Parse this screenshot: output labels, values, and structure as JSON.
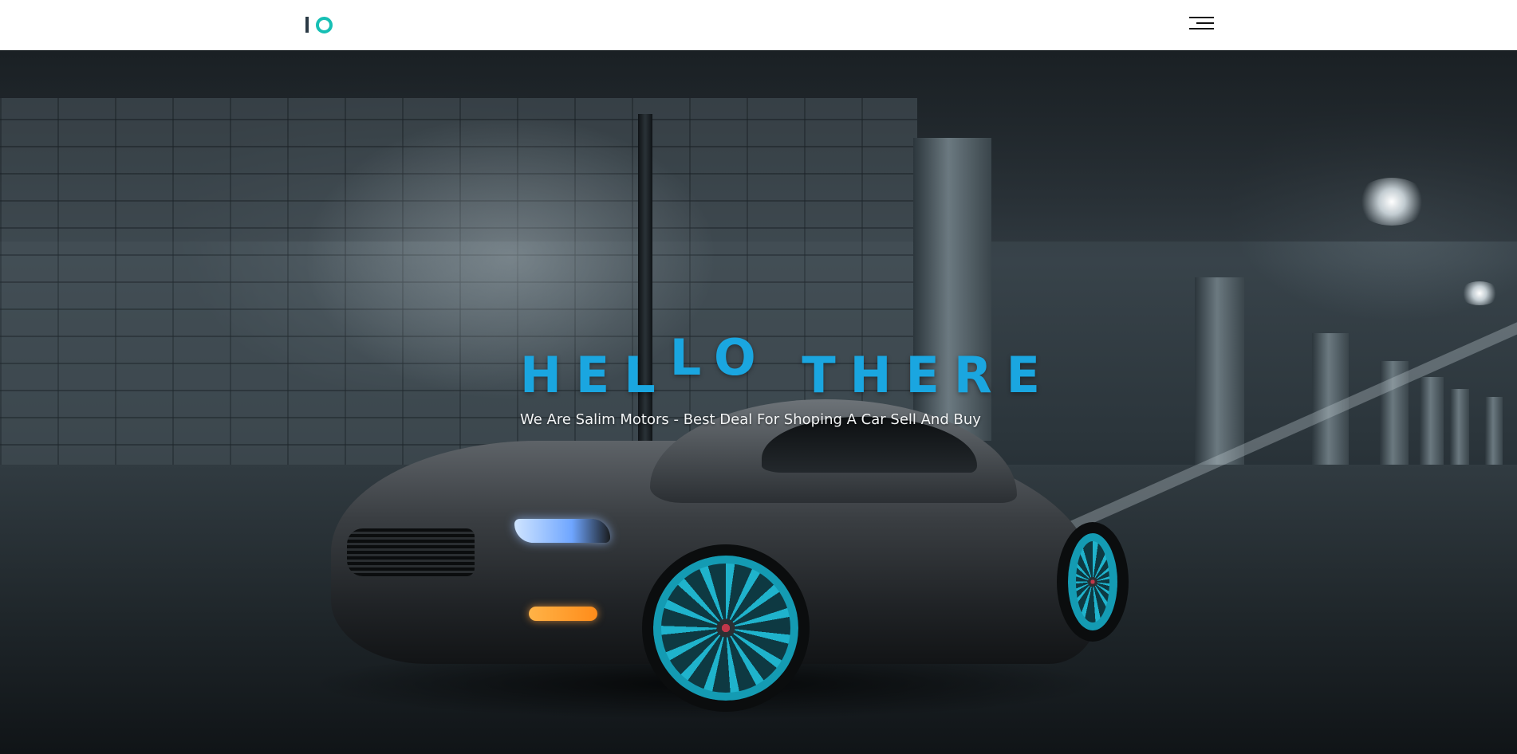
{
  "header": {
    "logo_text": "IO",
    "logo_colors": {
      "bar": "#2b3a45",
      "ring": "#16bfb4"
    },
    "menu_icon": "hamburger-menu-icon"
  },
  "hero": {
    "title_parts": [
      "HEL",
      "LO",
      " THERE"
    ],
    "subtitle": "We Are Salim Motors - Best Deal For Shoping A Car Sell And Buy",
    "title_color": "#1aa6e0",
    "subtitle_color": "#f2f4f5",
    "background_image": "dark-parking-garage-sports-car-photo"
  }
}
